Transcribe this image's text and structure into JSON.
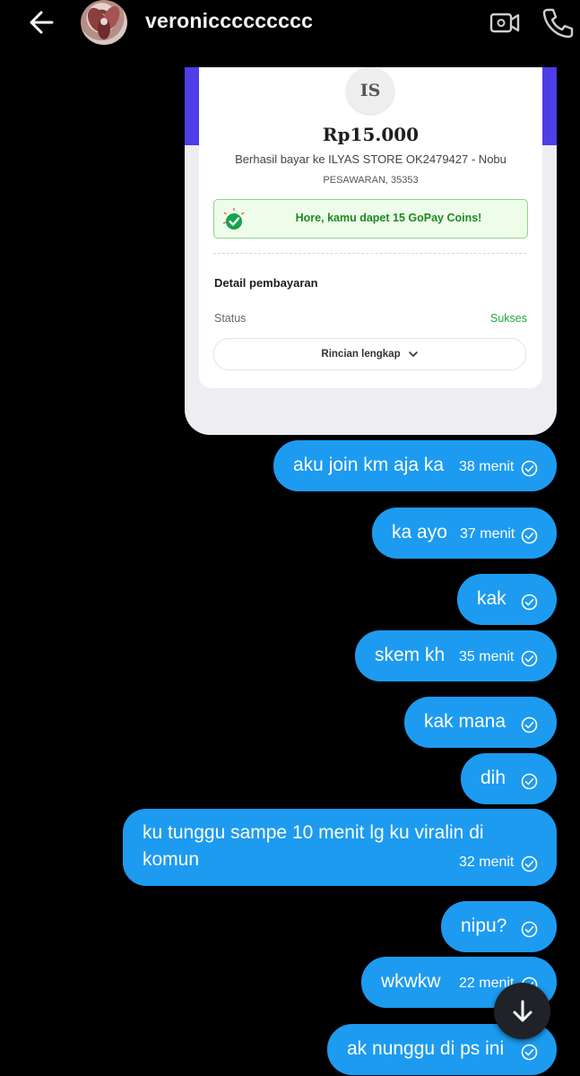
{
  "header": {
    "username": "veroniccccccccc",
    "back_icon": "arrow-left-icon",
    "video_icon": "video-camera-icon",
    "call_icon": "phone-icon"
  },
  "receipt": {
    "merchant_initials": "IS",
    "amount": "Rp15.000",
    "paid_to": "Berhasil bayar ke ILYAS STORE OK2479427 - Nobu",
    "location": "PESAWARAN, 35353",
    "coins_banner": "Hore, kamu dapet 15 GoPay Coins!",
    "detail_title": "Detail pembayaran",
    "status_label": "Status",
    "status_value": "Sukses",
    "details_button": "Rincian lengkap",
    "colors": {
      "accent": "#4d3ee8",
      "success": "#24a33a"
    }
  },
  "messages": [
    {
      "text": "aku join km aja ka",
      "time": "38 menit"
    },
    {
      "text": "ka ayo",
      "time": "37 menit"
    },
    {
      "text": "kak",
      "time": ""
    },
    {
      "text": "skem kh",
      "time": "35 menit"
    },
    {
      "text": "kak mana",
      "time": ""
    },
    {
      "text": "dih",
      "time": ""
    },
    {
      "text_line1": "ku tunggu sampe 10 menit lg ku viralin di",
      "text_line2": "komun",
      "time": "32 menit"
    },
    {
      "text": "nipu?",
      "time": ""
    },
    {
      "text": "wkwkw",
      "time": "22 menit"
    },
    {
      "text": "ak nunggu di ps ini",
      "time": ""
    }
  ],
  "colors": {
    "bubble": "#1d9bf0",
    "background": "#000000"
  }
}
